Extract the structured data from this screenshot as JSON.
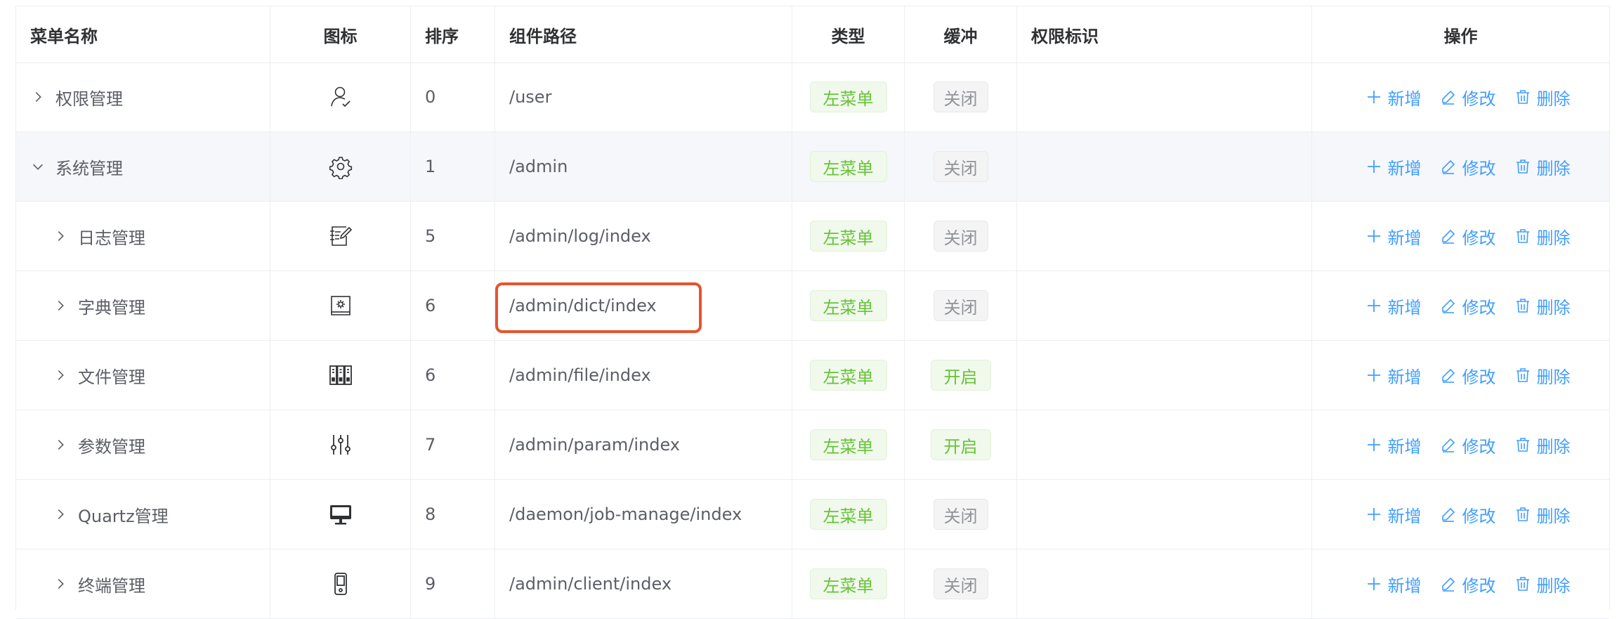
{
  "columns": {
    "name": "菜单名称",
    "icon": "图标",
    "sort": "排序",
    "path": "组件路径",
    "type": "类型",
    "cache": "缓冲",
    "perm": "权限标识",
    "ops": "操作"
  },
  "actions": {
    "add": "新增",
    "edit": "修改",
    "delete": "删除"
  },
  "rows": [
    {
      "name": "权限管理",
      "icon": "user-check-icon",
      "sort": "0",
      "path": "/user",
      "type": "左菜单",
      "cache": "关闭",
      "perm": ""
    },
    {
      "name": "系统管理",
      "icon": "gear-icon",
      "sort": "1",
      "path": "/admin",
      "type": "左菜单",
      "cache": "关闭",
      "perm": ""
    },
    {
      "name": "日志管理",
      "icon": "edit-document-icon",
      "sort": "5",
      "path": "/admin/log/index",
      "type": "左菜单",
      "cache": "关闭",
      "perm": ""
    },
    {
      "name": "字典管理",
      "icon": "dictionary-book-icon",
      "sort": "6",
      "path": "/admin/dict/index",
      "type": "左菜单",
      "cache": "关闭",
      "perm": ""
    },
    {
      "name": "文件管理",
      "icon": "file-cabinet-icon",
      "sort": "6",
      "path": "/admin/file/index",
      "type": "左菜单",
      "cache": "开启",
      "perm": ""
    },
    {
      "name": "参数管理",
      "icon": "sliders-icon",
      "sort": "7",
      "path": "/admin/param/index",
      "type": "左菜单",
      "cache": "开启",
      "perm": ""
    },
    {
      "name": "Quartz管理",
      "icon": "monitor-icon",
      "sort": "8",
      "path": "/daemon/job-manage/index",
      "type": "左菜单",
      "cache": "关闭",
      "perm": ""
    },
    {
      "name": "终端管理",
      "icon": "mobile-phone-icon",
      "sort": "9",
      "path": "/admin/client/index",
      "type": "左菜单",
      "cache": "关闭",
      "perm": ""
    }
  ],
  "colors": {
    "accent": "#409eff",
    "tag_green": "#67c23a",
    "tag_gray": "#909399",
    "highlight": "#e8532e"
  }
}
